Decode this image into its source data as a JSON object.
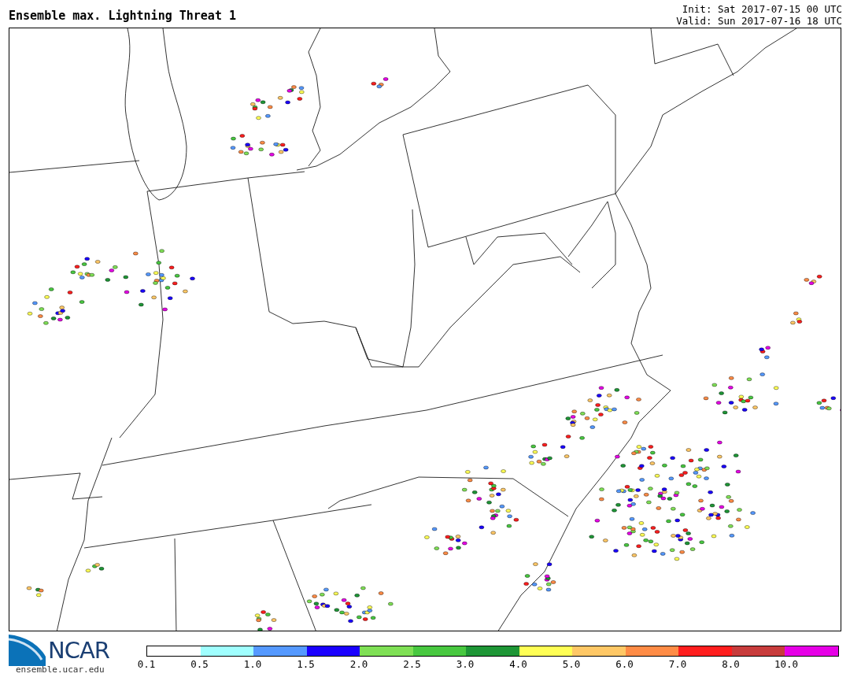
{
  "header": {
    "title": "Ensemble max. Lightning Threat 1",
    "init": "Init: Sat 2017-07-15 00 UTC",
    "valid": "Valid: Sun 2017-07-16 18 UTC"
  },
  "footer": {
    "logo_text": "NCAR",
    "url": "ensemble.ucar.edu"
  },
  "colorbar": [
    {
      "label": "0.1",
      "color": "#ffffff"
    },
    {
      "label": "0.5",
      "color": "#a0ffff"
    },
    {
      "label": "1.0",
      "color": "#5599ff"
    },
    {
      "label": "1.5",
      "color": "#1a00ff"
    },
    {
      "label": "2.0",
      "color": "#7fe055"
    },
    {
      "label": "2.5",
      "color": "#48c840"
    },
    {
      "label": "3.0",
      "color": "#1e9636"
    },
    {
      "label": "4.0",
      "color": "#ffff55"
    },
    {
      "label": "5.0",
      "color": "#ffc866"
    },
    {
      "label": "6.0",
      "color": "#ff8c46"
    },
    {
      "label": "7.0",
      "color": "#ff1e1e"
    },
    {
      "label": "8.0",
      "color": "#c83c3c"
    },
    {
      "label": "10.0",
      "color": "#e600e6"
    }
  ]
}
